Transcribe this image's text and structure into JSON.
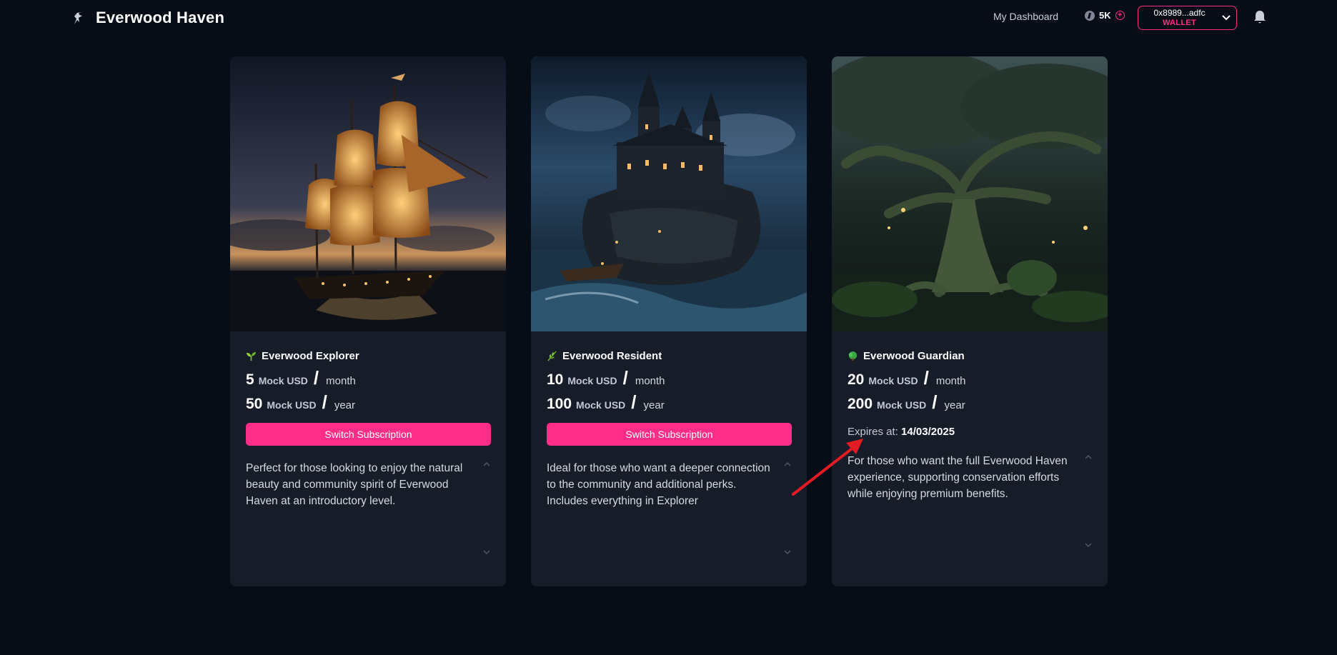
{
  "header": {
    "brand": "Everwood Haven",
    "nav_dashboard": "My Dashboard",
    "credits": "5K",
    "wallet_address": "0x8989...adfc",
    "wallet_label": "WALLET"
  },
  "cards": [
    {
      "title": "Everwood Explorer",
      "icon": "seedling-icon",
      "monthly_price": "5",
      "monthly_unit": "Mock USD",
      "monthly_period": "month",
      "yearly_price": "50",
      "yearly_unit": "Mock USD",
      "yearly_period": "year",
      "button": "Switch Subscription",
      "description": "Perfect for those looking to enjoy the natural beauty and community spirit of Everwood Haven at an introductory level."
    },
    {
      "title": "Everwood Resident",
      "icon": "herb-icon",
      "monthly_price": "10",
      "monthly_unit": "Mock USD",
      "monthly_period": "month",
      "yearly_price": "100",
      "yearly_unit": "Mock USD",
      "yearly_period": "year",
      "button": "Switch Subscription",
      "description": "Ideal for those who want a deeper connection to the community and additional perks. Includes everything in Explorer"
    },
    {
      "title": "Everwood Guardian",
      "icon": "tree-icon",
      "monthly_price": "20",
      "monthly_unit": "Mock USD",
      "monthly_period": "month",
      "yearly_price": "200",
      "yearly_unit": "Mock USD",
      "yearly_period": "year",
      "expires_label": "Expires at:",
      "expires_date": "14/03/2025",
      "description": "For those who want the full Everwood Haven experience, supporting conservation efforts while enjoying premium benefits."
    }
  ],
  "colors": {
    "accent": "#ff2d87",
    "background": "#070d17",
    "card": "#161c28",
    "annotation_arrow": "#e31b23"
  }
}
